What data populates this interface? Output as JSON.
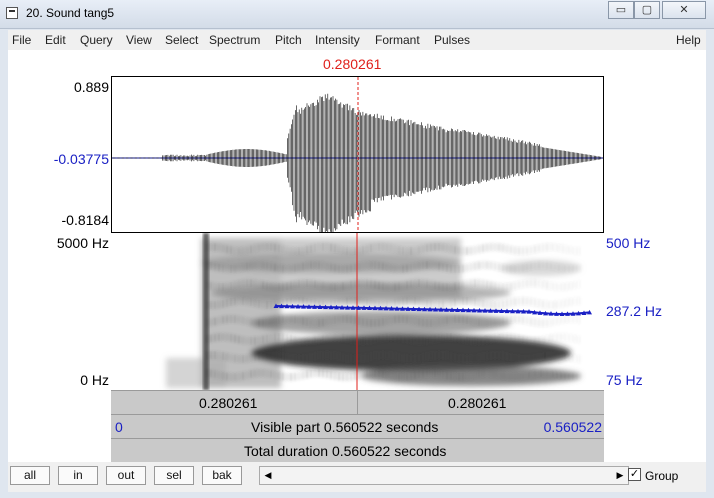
{
  "window": {
    "title": "20. Sound tang5",
    "minimize_glyph": "▭",
    "maximize_glyph": "▢",
    "close_glyph": "✕"
  },
  "menu": {
    "items": [
      "File",
      "Edit",
      "Query",
      "View",
      "Select",
      "Spectrum",
      "Pitch",
      "Intensity",
      "Formant",
      "Pulses"
    ],
    "help": "Help"
  },
  "cursor": {
    "time": "0.280261"
  },
  "waveform": {
    "max_label": "0.889",
    "zero_label": "-0.03775",
    "min_label": "-0.8184"
  },
  "spectrogram": {
    "top_label": "5000 Hz",
    "bottom_label": "0 Hz"
  },
  "pitch": {
    "top_label": "500 Hz",
    "value_label": "287.2 Hz",
    "bottom_label": "75 Hz"
  },
  "bars": {
    "left_time": "0.280261",
    "right_time": "0.280261",
    "start": "0",
    "end": "0.560522",
    "visible": "Visible part 0.560522 seconds",
    "total": "Total duration 0.560522 seconds"
  },
  "buttons": {
    "all": "all",
    "in": "in",
    "out": "out",
    "sel": "sel",
    "bak": "bak"
  },
  "scroll": {
    "left_arrow": "◀",
    "right_arrow": "▶"
  },
  "group": {
    "label": "Group",
    "checked": true,
    "check_glyph": "✓"
  },
  "colors": {
    "cursor": "#e0201b",
    "pitch": "#1a20c4",
    "wave": "#000000"
  }
}
